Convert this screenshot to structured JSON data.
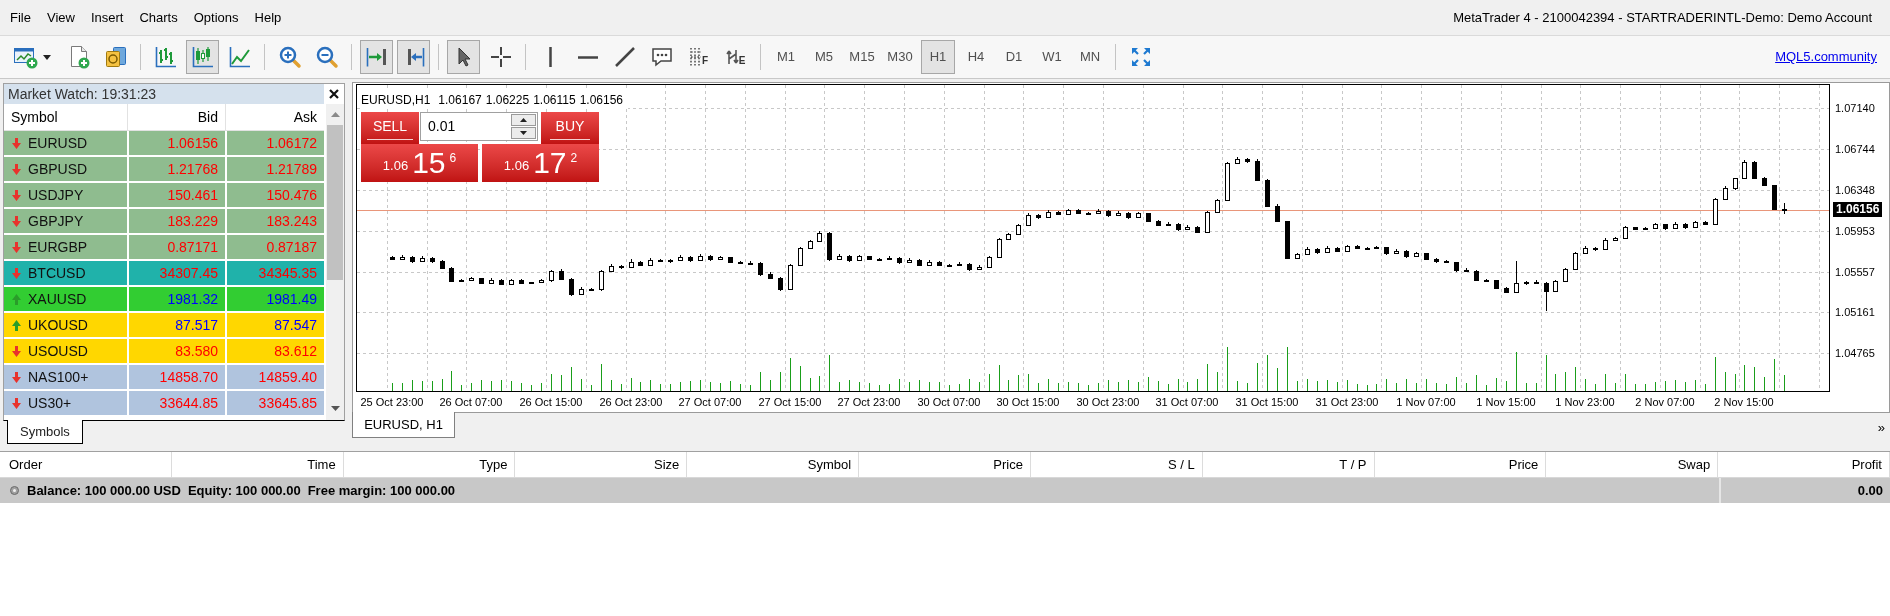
{
  "menu_bar": {
    "items": [
      "File",
      "View",
      "Insert",
      "Charts",
      "Options",
      "Help"
    ],
    "window_title": "MetaTrader 4 - 2100042394 - STARTRADERINTL-Demo: Demo Account"
  },
  "toolbar": {
    "groups": [
      {
        "tools": [
          {
            "kind": "newchart",
            "selected": false
          },
          {
            "kind": "neworder",
            "selected": false
          },
          {
            "kind": "profiles",
            "selected": false
          }
        ]
      },
      {
        "tools": [
          {
            "kind": "bars",
            "selected": false
          },
          {
            "kind": "candles",
            "selected": true
          },
          {
            "kind": "line",
            "selected": false
          }
        ]
      },
      {
        "tools": [
          {
            "kind": "zoomin",
            "selected": false
          },
          {
            "kind": "zoomout",
            "selected": false
          }
        ]
      },
      {
        "tools": [
          {
            "kind": "autoscroll",
            "selected": true
          },
          {
            "kind": "shift",
            "selected": true
          }
        ]
      },
      {
        "tools": [
          {
            "kind": "cursor",
            "selected": true
          },
          {
            "kind": "crosshair",
            "selected": false
          }
        ]
      },
      {
        "tools": [
          {
            "kind": "vline",
            "selected": false
          },
          {
            "kind": "hline",
            "selected": false
          },
          {
            "kind": "trendline",
            "selected": false
          },
          {
            "kind": "text",
            "selected": false
          },
          {
            "kind": "fibo",
            "selected": false,
            "label": "F"
          },
          {
            "kind": "elliott",
            "selected": false,
            "label": "E"
          }
        ]
      }
    ],
    "timeframes": [
      {
        "label": "M1",
        "selected": false
      },
      {
        "label": "M5",
        "selected": false
      },
      {
        "label": "M15",
        "selected": false
      },
      {
        "label": "M30",
        "selected": false
      },
      {
        "label": "H1",
        "selected": true
      },
      {
        "label": "H4",
        "selected": false
      },
      {
        "label": "D1",
        "selected": false
      },
      {
        "label": "W1",
        "selected": false
      },
      {
        "label": "MN",
        "selected": false
      }
    ],
    "tail_tools": [
      {
        "kind": "fullscreen",
        "selected": false
      }
    ],
    "community_link": "MQL5.community"
  },
  "market_watch": {
    "title": "Market Watch: 19:31:23",
    "columns": [
      "Symbol",
      "Bid",
      "Ask"
    ],
    "rows": [
      {
        "symbol": "EURUSD",
        "bid": "1.06156",
        "ask": "1.06172",
        "rising": false,
        "color": "#8fbc8f"
      },
      {
        "symbol": "GBPUSD",
        "bid": "1.21768",
        "ask": "1.21789",
        "rising": false,
        "color": "#8fbc8f"
      },
      {
        "symbol": "USDJPY",
        "bid": "150.461",
        "ask": "150.476",
        "rising": false,
        "color": "#8fbc8f"
      },
      {
        "symbol": "GBPJPY",
        "bid": "183.229",
        "ask": "183.243",
        "rising": false,
        "color": "#8fbc8f"
      },
      {
        "symbol": "EURGBP",
        "bid": "0.87171",
        "ask": "0.87187",
        "rising": false,
        "color": "#8fbc8f"
      },
      {
        "symbol": "BTCUSD",
        "bid": "34307.45",
        "ask": "34345.35",
        "rising": false,
        "color": "#20b2aa"
      },
      {
        "symbol": "XAUUSD",
        "bid": "1981.32",
        "ask": "1981.49",
        "rising": true,
        "color": "#32cd32"
      },
      {
        "symbol": "UKOUSD",
        "bid": "87.517",
        "ask": "87.547",
        "rising": true,
        "color": "#ffd700"
      },
      {
        "symbol": "USOUSD",
        "bid": "83.580",
        "ask": "83.612",
        "rising": false,
        "color": "#ffd700"
      },
      {
        "symbol": "NAS100+",
        "bid": "14858.70",
        "ask": "14859.40",
        "rising": false,
        "color": "#b0c4de"
      },
      {
        "symbol": "US30+",
        "bid": "33644.85",
        "ask": "33645.85",
        "rising": false,
        "color": "#b0c4de"
      }
    ],
    "tabs": [
      {
        "label": "Symbols",
        "selected": true
      }
    ]
  },
  "chart": {
    "symbol": "EURUSD,H1",
    "ohlc": [
      "1.06167",
      "1.06225",
      "1.06115",
      "1.06156"
    ],
    "trade_panel": {
      "sell_label": "SELL",
      "buy_label": "BUY",
      "lot": "0.01",
      "sell_quote": {
        "base": "1.06",
        "pips": "15",
        "fraction": "6"
      },
      "buy_quote": {
        "base": "1.06",
        "pips": "17",
        "fraction": "2"
      }
    },
    "chart_data": {
      "type": "candlestick",
      "categories": [
        null,
        null,
        null,
        "25 Oct 23:00",
        null,
        null,
        null,
        null,
        null,
        null,
        null,
        "26 Oct 07:00",
        null,
        null,
        null,
        null,
        null,
        null,
        null,
        "26 Oct 15:00",
        null,
        null,
        null,
        null,
        null,
        null,
        null,
        "26 Oct 23:00",
        null,
        null,
        null,
        null,
        null,
        null,
        null,
        "27 Oct 07:00",
        null,
        null,
        null,
        null,
        null,
        null,
        null,
        "27 Oct 15:00",
        null,
        null,
        null,
        null,
        null,
        null,
        null,
        "27 Oct 23:00",
        null,
        null,
        null,
        null,
        null,
        null,
        null,
        "30 Oct 07:00",
        null,
        null,
        null,
        null,
        null,
        null,
        null,
        "30 Oct 15:00",
        null,
        null,
        null,
        null,
        null,
        null,
        null,
        "30 Oct 23:00",
        null,
        null,
        null,
        null,
        null,
        null,
        null,
        "31 Oct 07:00",
        null,
        null,
        null,
        null,
        null,
        null,
        null,
        "31 Oct 15:00",
        null,
        null,
        null,
        null,
        null,
        null,
        null,
        "31 Oct 23:00",
        null,
        null,
        null,
        null,
        null,
        null,
        null,
        "1 Nov 07:00",
        null,
        null,
        null,
        null,
        null,
        null,
        null,
        "1 Nov 15:00",
        null,
        null,
        null,
        null,
        null,
        null,
        null,
        "1 Nov 23:00",
        null,
        null,
        null,
        null,
        null,
        null,
        null,
        "2 Nov 07:00",
        null,
        null,
        null,
        null,
        null,
        null,
        null,
        "2 Nov 15:00",
        null,
        null,
        null,
        null,
        null,
        null,
        null,
        null
      ],
      "ohlc": [
        null,
        null,
        null,
        [
          1.057,
          1.05708,
          1.05669,
          1.05681
        ],
        [
          1.05681,
          1.05718,
          1.05675,
          1.05703
        ],
        [
          1.05703,
          1.05708,
          1.05645,
          1.05663
        ],
        [
          1.05663,
          1.05713,
          1.05655,
          1.05693
        ],
        [
          1.05693,
          1.05703,
          1.05642,
          1.05656
        ],
        [
          1.05656,
          1.05668,
          1.05591,
          1.05596
        ],
        [
          1.05596,
          1.05602,
          1.0546,
          1.0547
        ],
        [
          1.0547,
          1.05483,
          1.05458,
          1.05475
        ],
        [
          1.05475,
          1.05509,
          1.05469,
          1.05494
        ],
        [
          1.05494,
          1.05499,
          1.05433,
          1.05451
        ],
        [
          1.05451,
          1.05498,
          1.05443,
          1.05478
        ],
        [
          1.05478,
          1.05488,
          1.05424,
          1.05438
        ],
        [
          1.05438,
          1.05488,
          1.05433,
          1.05476
        ],
        [
          1.05476,
          1.05482,
          1.05438,
          1.05448
        ],
        [
          1.05448,
          1.05461,
          1.05436,
          1.05453
        ],
        [
          1.05453,
          1.05487,
          1.05447,
          1.05472
        ],
        [
          1.05472,
          1.05572,
          1.05454,
          1.05567
        ],
        [
          1.05567,
          1.05587,
          1.05478,
          1.05486
        ],
        [
          1.05486,
          1.05496,
          1.05324,
          1.05338
        ],
        [
          1.05338,
          1.05405,
          1.05333,
          1.05393
        ],
        [
          1.05393,
          1.05399,
          1.05374,
          1.05384
        ],
        [
          1.05384,
          1.05573,
          1.05372,
          1.05565
        ],
        [
          1.05565,
          1.05628,
          1.05559,
          1.05613
        ],
        [
          1.05613,
          1.05618,
          1.05581,
          1.05599
        ],
        [
          1.05599,
          1.05675,
          1.05591,
          1.05655
        ],
        [
          1.05655,
          1.05665,
          1.05611,
          1.05625
        ],
        [
          1.05625,
          1.05686,
          1.0562,
          1.05674
        ],
        [
          1.05674,
          1.0568,
          1.05647,
          1.05657
        ],
        [
          1.05657,
          1.0568,
          1.05645,
          1.05672
        ],
        [
          1.05672,
          1.05716,
          1.05666,
          1.05701
        ],
        [
          1.05701,
          1.05706,
          1.0565,
          1.05668
        ],
        [
          1.05668,
          1.05726,
          1.0566,
          1.05706
        ],
        [
          1.05706,
          1.05716,
          1.05662,
          1.05676
        ],
        [
          1.05676,
          1.0571,
          1.05671,
          1.05698
        ],
        [
          1.05698,
          1.05704,
          1.05644,
          1.05654
        ],
        [
          1.05654,
          1.05662,
          1.05631,
          1.05643
        ],
        [
          1.05643,
          1.0566,
          1.05637,
          1.05645
        ],
        [
          1.05645,
          1.0565,
          1.05516,
          1.05534
        ],
        [
          1.05534,
          1.05554,
          1.05486,
          1.05494
        ],
        [
          1.05494,
          1.05504,
          1.05372,
          1.05386
        ],
        [
          1.05386,
          1.05632,
          1.05381,
          1.0562
        ],
        [
          1.0562,
          1.05795,
          1.0561,
          1.05789
        ],
        [
          1.05789,
          1.05863,
          1.05777,
          1.05855
        ],
        [
          1.05855,
          1.0595,
          1.05849,
          1.05935
        ],
        [
          1.05935,
          1.0594,
          1.05665,
          1.05683
        ],
        [
          1.05683,
          1.05729,
          1.05675,
          1.05709
        ],
        [
          1.05709,
          1.05719,
          1.05654,
          1.05668
        ],
        [
          1.05668,
          1.05717,
          1.05663,
          1.05705
        ],
        [
          1.05705,
          1.05711,
          1.05667,
          1.05677
        ],
        [
          1.05677,
          1.05689,
          1.05665,
          1.05681
        ],
        [
          1.05681,
          1.05709,
          1.05675,
          1.05694
        ],
        [
          1.05694,
          1.05699,
          1.05628,
          1.05646
        ],
        [
          1.05646,
          1.05687,
          1.05638,
          1.05667
        ],
        [
          1.05667,
          1.05677,
          1.05607,
          1.05621
        ],
        [
          1.05621,
          1.05666,
          1.05616,
          1.05654
        ],
        [
          1.05654,
          1.0566,
          1.05611,
          1.05621
        ],
        [
          1.05621,
          1.05629,
          1.05608,
          1.0562
        ],
        [
          1.0562,
          1.05649,
          1.05614,
          1.05634
        ],
        [
          1.05634,
          1.05639,
          1.05567,
          1.05585
        ],
        [
          1.05585,
          1.05626,
          1.05577,
          1.05606
        ],
        [
          1.05606,
          1.0571,
          1.05592,
          1.057
        ],
        [
          1.057,
          1.05883,
          1.05695,
          1.05871
        ],
        [
          1.05871,
          1.0593,
          1.05861,
          1.05924
        ],
        [
          1.05924,
          1.06018,
          1.05912,
          1.0601
        ],
        [
          1.0601,
          1.06124,
          1.06004,
          1.06109
        ],
        [
          1.06109,
          1.06114,
          1.0607,
          1.06088
        ],
        [
          1.06088,
          1.06158,
          1.0608,
          1.06138
        ],
        [
          1.06138,
          1.06148,
          1.06106,
          1.0612
        ],
        [
          1.0612,
          1.06168,
          1.06115,
          1.06156
        ],
        [
          1.06156,
          1.06162,
          1.06117,
          1.06127
        ],
        [
          1.06127,
          1.06138,
          1.06115,
          1.0613
        ],
        [
          1.0613,
          1.06162,
          1.06124,
          1.06147
        ],
        [
          1.06147,
          1.06152,
          1.06085,
          1.06103
        ],
        [
          1.06103,
          1.06148,
          1.06095,
          1.06128
        ],
        [
          1.06128,
          1.06138,
          1.06072,
          1.06086
        ],
        [
          1.06086,
          1.06134,
          1.06081,
          1.06122
        ],
        [
          1.06122,
          1.06128,
          1.0604,
          1.0605
        ],
        [
          1.0605,
          1.06058,
          1.05998,
          1.0601
        ],
        [
          1.0601,
          1.06037,
          1.06004,
          1.06022
        ],
        [
          1.06022,
          1.06027,
          1.05955,
          1.05973
        ],
        [
          1.05973,
          1.06013,
          1.05965,
          1.05993
        ],
        [
          1.05993,
          1.06003,
          1.05932,
          1.05946
        ],
        [
          1.05946,
          1.06144,
          1.05941,
          1.06132
        ],
        [
          1.06132,
          1.06259,
          1.06122,
          1.06253
        ],
        [
          1.06253,
          1.06617,
          1.06241,
          1.06609
        ],
        [
          1.06609,
          1.06665,
          1.06603,
          1.0665
        ],
        [
          1.0665,
          1.06655,
          1.06611,
          1.06629
        ],
        [
          1.06629,
          1.06649,
          1.06439,
          1.06447
        ],
        [
          1.06447,
          1.06457,
          1.06183,
          1.06197
        ],
        [
          1.06197,
          1.06209,
          1.0604,
          1.06045
        ],
        [
          1.06045,
          1.06051,
          1.05683,
          1.05693
        ],
        [
          1.05693,
          1.05738,
          1.05681,
          1.0573
        ],
        [
          1.0573,
          1.05796,
          1.05724,
          1.05781
        ],
        [
          1.05781,
          1.05786,
          1.05731,
          1.05749
        ],
        [
          1.05749,
          1.05806,
          1.05741,
          1.05786
        ],
        [
          1.05786,
          1.05796,
          1.05743,
          1.05757
        ],
        [
          1.05757,
          1.05817,
          1.05752,
          1.05805
        ],
        [
          1.05805,
          1.05811,
          1.05779,
          1.05789
        ],
        [
          1.05789,
          1.05797,
          1.05772,
          1.05784
        ],
        [
          1.05784,
          1.05808,
          1.05778,
          1.05793
        ],
        [
          1.05793,
          1.05798,
          1.05723,
          1.05741
        ],
        [
          1.05741,
          1.05778,
          1.05733,
          1.05758
        ],
        [
          1.05758,
          1.05768,
          1.05694,
          1.05708
        ],
        [
          1.05708,
          1.05748,
          1.05703,
          1.05736
        ],
        [
          1.05736,
          1.05742,
          1.05671,
          1.05681
        ],
        [
          1.05681,
          1.05689,
          1.05645,
          1.05657
        ],
        [
          1.05657,
          1.05672,
          1.05642,
          1.05648
        ],
        [
          1.05648,
          1.05653,
          1.05558,
          1.05576
        ],
        [
          1.05576,
          1.05596,
          1.05552,
          1.0556
        ],
        [
          1.0556,
          1.0557,
          1.05464,
          1.05478
        ],
        [
          1.05478,
          1.0549,
          1.05468,
          1.05473
        ],
        [
          1.05473,
          1.05479,
          1.05393,
          1.05403
        ],
        [
          1.05403,
          1.05411,
          1.05351,
          1.05363
        ],
        [
          1.05363,
          1.0566,
          1.05357,
          1.05443
        ],
        [
          1.05443,
          1.05465,
          1.05425,
          1.0546
        ],
        [
          1.0546,
          1.0548,
          1.05439,
          1.05447
        ],
        [
          1.05447,
          1.05457,
          1.0518,
          1.05367
        ],
        [
          1.05367,
          1.05478,
          1.05362,
          1.05466
        ],
        [
          1.05466,
          1.05593,
          1.05456,
          1.05587
        ],
        [
          1.05587,
          1.05747,
          1.05575,
          1.05739
        ],
        [
          1.05739,
          1.05805,
          1.05733,
          1.0579
        ],
        [
          1.0579,
          1.05795,
          1.05761,
          1.05779
        ],
        [
          1.05779,
          1.05887,
          1.05771,
          1.05867
        ],
        [
          1.05867,
          1.05898,
          1.05853,
          1.05888
        ],
        [
          1.05888,
          1.05999,
          1.05883,
          1.05987
        ],
        [
          1.05987,
          1.05993,
          1.0596,
          1.0597
        ],
        [
          1.0597,
          1.05993,
          1.05958,
          1.05985
        ],
        [
          1.05985,
          1.0603,
          1.05979,
          1.06015
        ],
        [
          1.06015,
          1.0602,
          1.05964,
          1.05982
        ],
        [
          1.05982,
          1.06039,
          1.05974,
          1.06019
        ],
        [
          1.06019,
          1.06029,
          1.05975,
          1.05989
        ],
        [
          1.05989,
          1.0605,
          1.05984,
          1.06038
        ],
        [
          1.06038,
          1.06044,
          1.06011,
          1.06021
        ],
        [
          1.06021,
          1.06269,
          1.06009,
          1.06261
        ],
        [
          1.06261,
          1.06385,
          1.06255,
          1.0637
        ],
        [
          1.0637,
          1.06466,
          1.06352,
          1.06461
        ],
        [
          1.06461,
          1.06641,
          1.06453,
          1.06621
        ],
        [
          1.06621,
          1.06631,
          1.06454,
          1.06468
        ],
        [
          1.06468,
          1.0648,
          1.06388,
          1.06393
        ],
        [
          1.06393,
          1.06399,
          1.06157,
          1.06167
        ],
        [
          1.06167,
          1.06225,
          1.06115,
          1.06156
        ],
        null,
        null,
        null,
        null
      ],
      "ylim": [
        1.04399,
        1.07368
      ],
      "yticks": [
        {
          "value": 1.0714,
          "label": "1.07140"
        },
        {
          "value": 1.06744,
          "label": "1.06744"
        },
        {
          "value": 1.06348,
          "label": "1.06348"
        },
        {
          "value": 1.05953,
          "label": "1.05953"
        },
        {
          "value": 1.05557,
          "label": "1.05557"
        },
        {
          "value": 1.05161,
          "label": "1.05161"
        },
        {
          "value": 1.04765,
          "label": "1.04765"
        }
      ],
      "grid": true,
      "ref_lines": [
        {
          "axis": "y",
          "value": 1.06156,
          "label": "1.06156"
        }
      ]
    },
    "tabs": [
      {
        "label": "EURUSD, H1",
        "selected": true
      }
    ],
    "tabs_overflow": "»"
  },
  "terminal": {
    "columns": [
      "Order",
      "Time",
      "Type",
      "Size",
      "Symbol",
      "Price",
      "S / L",
      "T / P",
      "Price",
      "Swap",
      "Profit"
    ],
    "summary": {
      "balance": "Balance: 100 000.00 USD",
      "equity": "Equity: 100 000.00",
      "free_margin": "Free margin: 100 000.00",
      "profit": "0.00"
    }
  }
}
